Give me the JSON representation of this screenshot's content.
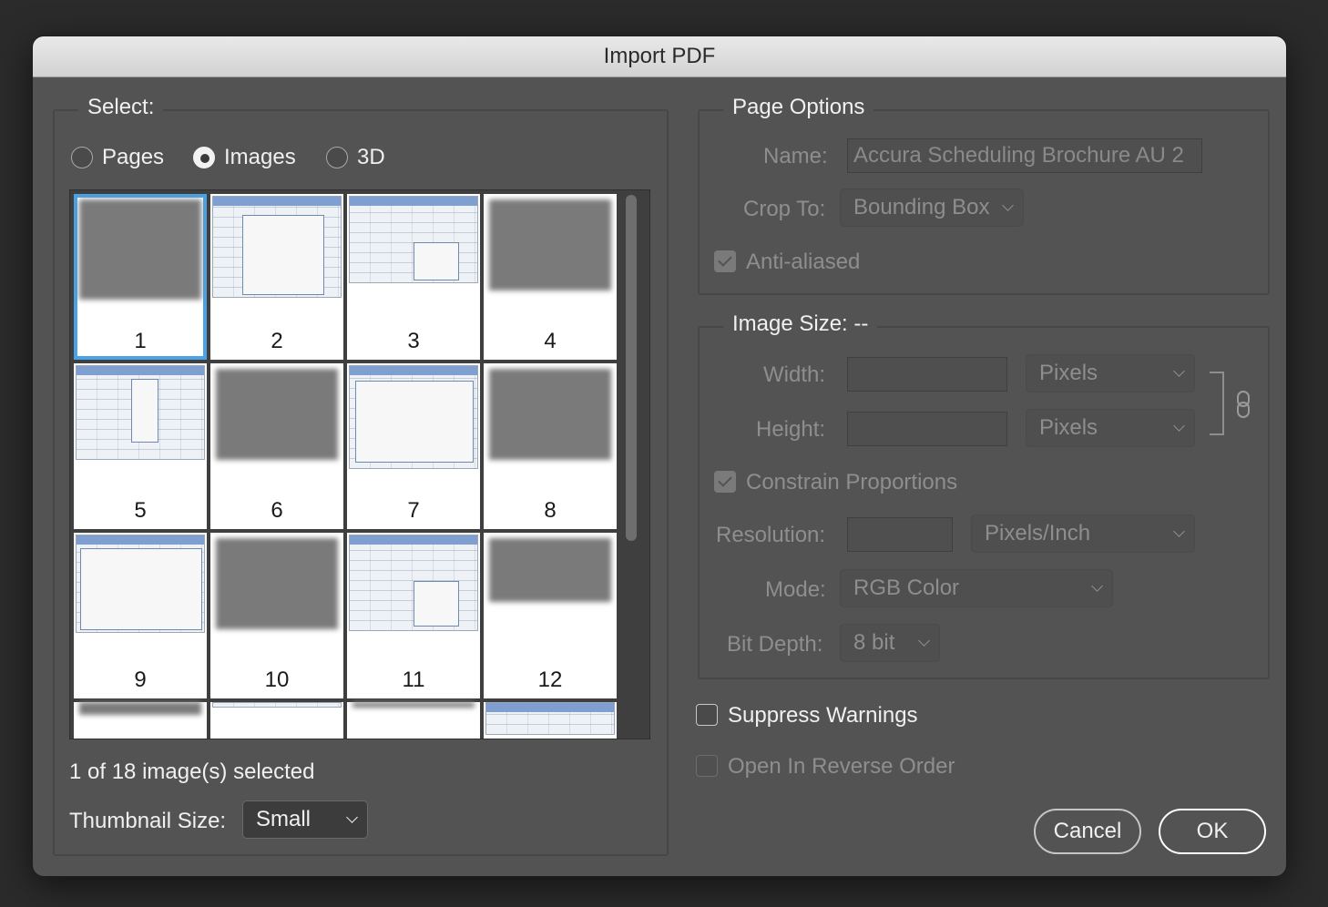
{
  "window": {
    "title": "Import PDF"
  },
  "select_group": {
    "title": "Select:",
    "radios": [
      {
        "label": "Pages",
        "checked": false
      },
      {
        "label": "Images",
        "checked": true
      },
      {
        "label": "3D",
        "checked": false
      }
    ],
    "thumbnails": [
      "1",
      "2",
      "3",
      "4",
      "5",
      "6",
      "7",
      "8",
      "9",
      "10",
      "11",
      "12"
    ],
    "selected_thumbnail": "1",
    "selection_status": "1 of 18 image(s) selected",
    "thumbnail_size_label": "Thumbnail Size:",
    "thumbnail_size_value": "Small"
  },
  "page_options": {
    "title": "Page Options",
    "name_label": "Name:",
    "name_value": "Accura Scheduling Brochure AU 2",
    "crop_label": "Crop To:",
    "crop_value": "Bounding Box",
    "anti_aliased_label": "Anti-aliased",
    "anti_aliased_checked": true
  },
  "image_size": {
    "title": "Image Size: --",
    "width_label": "Width:",
    "width_unit": "Pixels",
    "height_label": "Height:",
    "height_unit": "Pixels",
    "constrain_label": "Constrain Proportions",
    "constrain_checked": true,
    "resolution_label": "Resolution:",
    "resolution_unit": "Pixels/Inch",
    "mode_label": "Mode:",
    "mode_value": "RGB Color",
    "bit_depth_label": "Bit Depth:",
    "bit_depth_value": "8 bit"
  },
  "options": {
    "suppress_warnings_label": "Suppress Warnings",
    "suppress_warnings_checked": false,
    "reverse_order_label": "Open In Reverse Order",
    "reverse_order_checked": false
  },
  "buttons": {
    "cancel": "Cancel",
    "ok": "OK"
  },
  "colors": {
    "selection": "#4aa3e6",
    "dialog_bg": "#535353"
  }
}
